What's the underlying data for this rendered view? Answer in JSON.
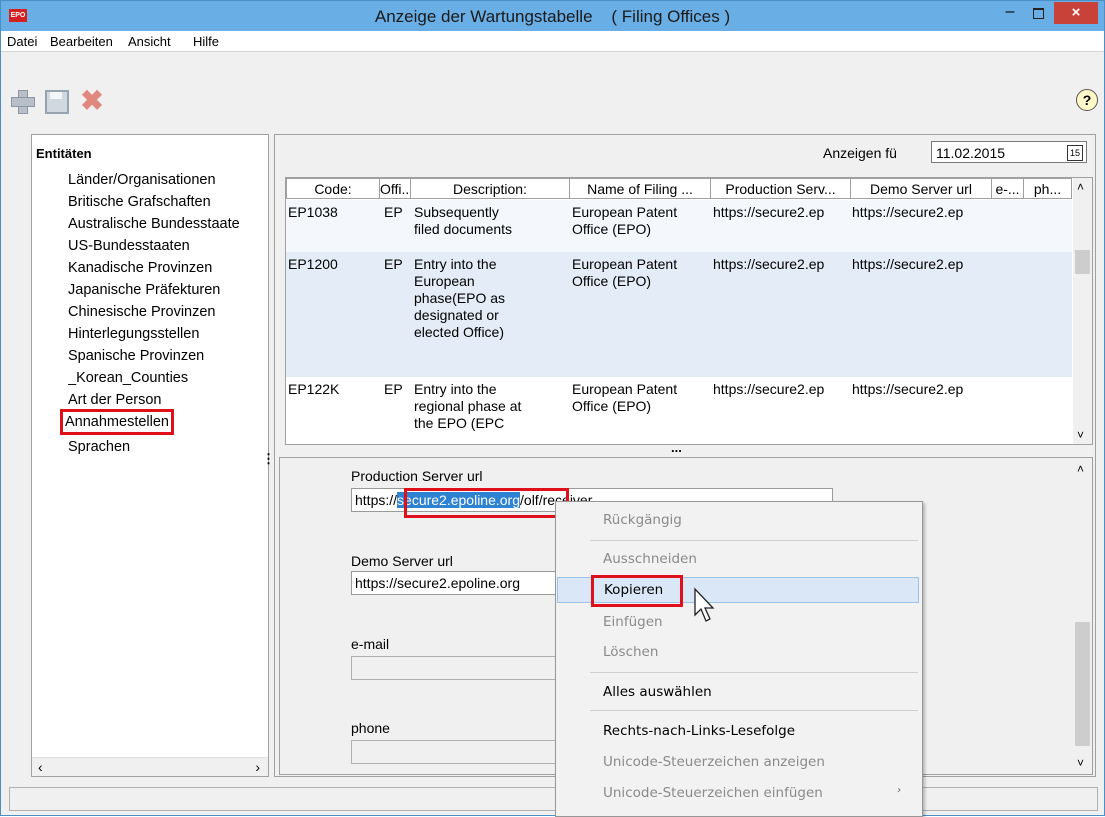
{
  "window": {
    "title": "Anzeige der Wartungstabelle    ( Filing Offices )",
    "app_icon": "EPO",
    "minimize": "–",
    "close": "×"
  },
  "menu": [
    "Datei",
    "Bearbeiten",
    "Ansicht",
    "Hilfe"
  ],
  "toolbar": {
    "add_icon": "plus-icon",
    "save_icon": "save-icon",
    "delete_icon": "delete-icon",
    "help": "?"
  },
  "sidebar": {
    "title": "Entitäten",
    "items": [
      "Länder/Organisationen",
      "Britische Grafschaften",
      "Australische Bundesstaate",
      "US-Bundesstaaten",
      "Kanadische Provinzen",
      "Japanische Präfekturen",
      "Chinesische Provinzen",
      "Hinterlegungsstellen",
      "Spanische Provinzen",
      "_Korean_Counties",
      "Art der Person",
      "Annahmestellen",
      "Sprachen"
    ],
    "selected_index": 11,
    "scroll_left": "‹",
    "scroll_right": "›"
  },
  "display_for": {
    "label": "Anzeigen fü",
    "date": "11.02.2015",
    "calendar_icon": "15"
  },
  "table": {
    "headers": [
      "Code:",
      "Offi...",
      "Description:",
      "Name of Filing ...",
      "Production Serv...",
      "Demo Server url",
      "e-...",
      "ph..."
    ],
    "rows": [
      {
        "code": "EP1038",
        "office": "EP",
        "description": "Subsequently\nfiled documents",
        "name": "European Patent\nOffice (EPO)",
        "production": "https://secure2.ep",
        "demo": "https://secure2.ep"
      },
      {
        "code": "EP1200",
        "office": "EP",
        "description": "Entry into the\nEuropean\nphase(EPO as\ndesignated or\nelected Office)",
        "name": "European Patent\nOffice (EPO)",
        "production": "https://secure2.ep",
        "demo": "https://secure2.ep"
      },
      {
        "code": "EP122K",
        "office": "EP",
        "description": "Entry into the\nregional phase at\nthe EPO (EPC",
        "name": "European Patent\nOffice (EPO)",
        "production": "https://secure2.ep",
        "demo": "https://secure2.ep"
      }
    ]
  },
  "splitter": "...",
  "form": {
    "production_label": "Production Server url",
    "production_prefix": "https://",
    "production_selected": "secure2.epoline.org",
    "production_suffix": "/olf/receiver",
    "demo_label": "Demo Server url",
    "demo_value": "https://secure2.epoline.org",
    "email_label": "e-mail",
    "email_value": "",
    "phone_label": "phone",
    "phone_value": ""
  },
  "context_menu": {
    "undo": "Rückgängig",
    "cut": "Ausschneiden",
    "copy": "Kopieren",
    "paste": "Einfügen",
    "delete": "Löschen",
    "select_all": "Alles auswählen",
    "rtl": "Rechts-nach-Links-Lesefolge",
    "show_unicode": "Unicode-Steuerzeichen anzeigen",
    "insert_unicode": "Unicode-Steuerzeichen einfügen",
    "submenu_arrow": "›"
  },
  "scroll_up": "˄",
  "scroll_down": "˅"
}
